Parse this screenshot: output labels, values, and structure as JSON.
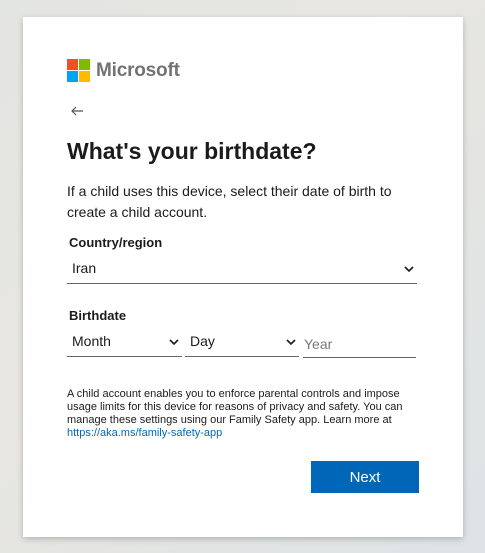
{
  "brand": {
    "name": "Microsoft",
    "colors": [
      "#f25022",
      "#7fba00",
      "#00a4ef",
      "#ffb900"
    ]
  },
  "nav": {
    "back_icon": "arrow-left-icon"
  },
  "title": "What's your birthdate?",
  "description": "If a child uses this device, select their date of birth to create a child account.",
  "country": {
    "label": "Country/region",
    "selected": "Iran"
  },
  "birthdate": {
    "label": "Birthdate",
    "month": "Month",
    "day": "Day",
    "year_placeholder": "Year"
  },
  "note": {
    "text": "A child account enables you to enforce parental controls and impose usage limits for this device for reasons of privacy and safety. You can manage these settings using our Family Safety app. Learn more at ",
    "link": "https://aka.ms/family-safety-app"
  },
  "actions": {
    "next_label": "Next"
  },
  "theme": {
    "accent": "#0067b8"
  }
}
